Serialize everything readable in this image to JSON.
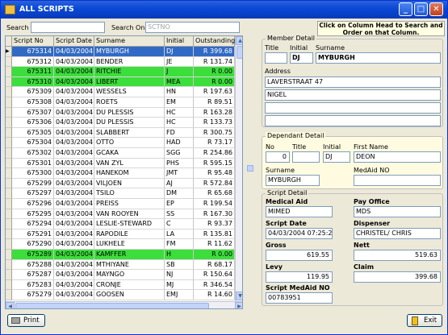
{
  "window": {
    "title": "ALL SCRIPTS"
  },
  "toolbar": {
    "search_label": "Search",
    "search_value": "",
    "search_on_label": "Search On",
    "search_on_value": "SCTNO",
    "hint": "Click on Column Head to Search and Order on that Column."
  },
  "grid": {
    "columns": [
      "Script No",
      "Script Date",
      "Surname",
      "Initial",
      "Outstanding"
    ],
    "rows": [
      {
        "no": "675314",
        "date": "04/03/2004",
        "surname": "MYBURGH",
        "initial": "DJ",
        "amount": "R 399.68",
        "state": "selected"
      },
      {
        "no": "675312",
        "date": "04/03/2004",
        "surname": "BENDER",
        "initial": "JE",
        "amount": "R 131.74",
        "state": ""
      },
      {
        "no": "675311",
        "date": "04/03/2004",
        "surname": "RITCHIE",
        "initial": "J",
        "amount": "R 0.00",
        "state": "green"
      },
      {
        "no": "675310",
        "date": "04/03/2004",
        "surname": "LIBERT",
        "initial": "MEA",
        "amount": "R 0.00",
        "state": "green"
      },
      {
        "no": "675309",
        "date": "04/03/2004",
        "surname": "WESSELS",
        "initial": "HN",
        "amount": "R 197.63",
        "state": ""
      },
      {
        "no": "675308",
        "date": "04/03/2004",
        "surname": "ROETS",
        "initial": "EM",
        "amount": "R 89.51",
        "state": ""
      },
      {
        "no": "675307",
        "date": "04/03/2004",
        "surname": "DU PLESSIS",
        "initial": "HC",
        "amount": "R 163.28",
        "state": ""
      },
      {
        "no": "675306",
        "date": "04/03/2004",
        "surname": "DU PLESSIS",
        "initial": "HC",
        "amount": "R 133.73",
        "state": ""
      },
      {
        "no": "675305",
        "date": "04/03/2004",
        "surname": "SLABBERT",
        "initial": "FD",
        "amount": "R 300.75",
        "state": ""
      },
      {
        "no": "675304",
        "date": "04/03/2004",
        "surname": "OTTO",
        "initial": "HAD",
        "amount": "R 73.17",
        "state": ""
      },
      {
        "no": "675302",
        "date": "04/03/2004",
        "surname": "GCAKA",
        "initial": "SGG",
        "amount": "R 254.86",
        "state": ""
      },
      {
        "no": "675301",
        "date": "04/03/2004",
        "surname": "VAN ZYL",
        "initial": "PHS",
        "amount": "R 595.15",
        "state": ""
      },
      {
        "no": "675300",
        "date": "04/03/2004",
        "surname": "HANEKOM",
        "initial": "JMT",
        "amount": "R 95.48",
        "state": ""
      },
      {
        "no": "675299",
        "date": "04/03/2004",
        "surname": "VILJOEN",
        "initial": "AJ",
        "amount": "R 572.84",
        "state": ""
      },
      {
        "no": "675297",
        "date": "04/03/2004",
        "surname": "TSILO",
        "initial": "DM",
        "amount": "R 65.68",
        "state": ""
      },
      {
        "no": "675296",
        "date": "04/03/2004",
        "surname": "PREISS",
        "initial": "EP",
        "amount": "R 199.54",
        "state": ""
      },
      {
        "no": "675295",
        "date": "04/03/2004",
        "surname": "VAN ROOYEN",
        "initial": "SS",
        "amount": "R 167.30",
        "state": ""
      },
      {
        "no": "675294",
        "date": "04/03/2004",
        "surname": "LESLIE-STEWARD",
        "initial": "C",
        "amount": "R 93.37",
        "state": ""
      },
      {
        "no": "675291",
        "date": "04/03/2004",
        "surname": "RAPODILE",
        "initial": "LA",
        "amount": "R 135.81",
        "state": ""
      },
      {
        "no": "675290",
        "date": "04/03/2004",
        "surname": "LUKHELE",
        "initial": "FM",
        "amount": "R 11.62",
        "state": ""
      },
      {
        "no": "675289",
        "date": "04/03/2004",
        "surname": "KAMFFER",
        "initial": "H",
        "amount": "R 0.00",
        "state": "green"
      },
      {
        "no": "675288",
        "date": "04/03/2004",
        "surname": "MTHIYANE",
        "initial": "SB",
        "amount": "R 68.17",
        "state": ""
      },
      {
        "no": "675287",
        "date": "04/03/2004",
        "surname": "MAYNGO",
        "initial": "NJ",
        "amount": "R 150.64",
        "state": ""
      },
      {
        "no": "675283",
        "date": "04/03/2004",
        "surname": "CRONJE",
        "initial": "MJ",
        "amount": "R 346.54",
        "state": ""
      },
      {
        "no": "675279",
        "date": "04/03/2004",
        "surname": "GOOSEN",
        "initial": "EMJ",
        "amount": "R 14.60",
        "state": ""
      }
    ]
  },
  "member": {
    "legend": "Member Detail",
    "title_label": "Title",
    "initial_label": "Initial",
    "surname_label": "Surname",
    "title": "",
    "initial": "DJ",
    "surname": "MYBURGH",
    "address_label": "Address",
    "address": [
      "LAVERSTRAAT 47",
      "",
      "NIGEL",
      "",
      ""
    ]
  },
  "dependant": {
    "legend": "Dependant Detail",
    "no_label": "No",
    "title_label": "Title",
    "initial_label": "Initial",
    "firstname_label": "First Name",
    "no": "0",
    "title": "",
    "initial": "DJ",
    "firstname": "DEON",
    "surname_label": "Surname",
    "medaid_label": "MedAid NO",
    "surname": "MYBURGH",
    "medaid": ""
  },
  "script": {
    "legend": "Script Detail",
    "medical_aid_label": "Medical Aid",
    "medical_aid": "MIMED",
    "pay_office_label": "Pay Office",
    "pay_office": "MDS",
    "script_date_label": "Script Date",
    "script_date": "04/03/2004 07:25:2",
    "dispenser_label": "Dispenser",
    "dispenser": "CHRISTEL/ CHRIS",
    "gross_label": "Gross",
    "gross": "619.55",
    "nett_label": "Nett",
    "nett": "519.63",
    "levy_label": "Levy",
    "levy": "119.95",
    "claim_label": "Claim",
    "claim": "399.68",
    "medaid_no_label": "Script MedAid NO",
    "medaid_no": "00783951"
  },
  "buttons": {
    "print": "Print",
    "exit": "Exit"
  }
}
